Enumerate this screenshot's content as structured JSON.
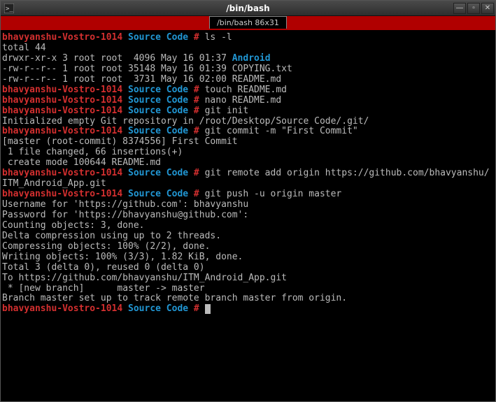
{
  "window": {
    "title": "/bin/bash"
  },
  "tab": {
    "label": "/bin/bash 86x31"
  },
  "prompt": {
    "host": "bhavyanshu-Vostro-1014",
    "cwd": "Source Code",
    "sep": " # "
  },
  "lines": [
    {
      "type": "prompt",
      "cmd": "ls -l"
    },
    {
      "type": "out",
      "text": "total 44"
    },
    {
      "type": "dir",
      "perm": "drwxr-xr-x 3 root root  4096 May 16 01:37 ",
      "name": "Android"
    },
    {
      "type": "out",
      "text": "-rw-r--r-- 1 root root 35148 May 16 01:39 COPYING.txt"
    },
    {
      "type": "out",
      "text": "-rw-r--r-- 1 root root  3731 May 16 02:00 README.md"
    },
    {
      "type": "prompt",
      "cmd": "touch README.md"
    },
    {
      "type": "prompt",
      "cmd": "nano README.md"
    },
    {
      "type": "prompt",
      "cmd": "git init"
    },
    {
      "type": "out",
      "text": "Initialized empty Git repository in /root/Desktop/Source Code/.git/"
    },
    {
      "type": "prompt",
      "cmd": "git commit -m \"First Commit\""
    },
    {
      "type": "out",
      "text": "[master (root-commit) 8374556] First Commit"
    },
    {
      "type": "out",
      "text": " 1 file changed, 66 insertions(+)"
    },
    {
      "type": "out",
      "text": " create mode 100644 README.md"
    },
    {
      "type": "prompt",
      "cmd": "git remote add origin https://github.com/bhavyanshu/ITM_Android_App.git"
    },
    {
      "type": "prompt",
      "cmd": "git push -u origin master"
    },
    {
      "type": "out",
      "text": "Username for 'https://github.com': bhavyanshu"
    },
    {
      "type": "out",
      "text": "Password for 'https://bhavyanshu@github.com':"
    },
    {
      "type": "out",
      "text": "Counting objects: 3, done."
    },
    {
      "type": "out",
      "text": "Delta compression using up to 2 threads."
    },
    {
      "type": "out",
      "text": "Compressing objects: 100% (2/2), done."
    },
    {
      "type": "out",
      "text": "Writing objects: 100% (3/3), 1.82 KiB, done."
    },
    {
      "type": "out",
      "text": "Total 3 (delta 0), reused 0 (delta 0)"
    },
    {
      "type": "out",
      "text": "To https://github.com/bhavyanshu/ITM_Android_App.git"
    },
    {
      "type": "out",
      "text": " * [new branch]      master -> master"
    },
    {
      "type": "out",
      "text": "Branch master set up to track remote branch master from origin."
    },
    {
      "type": "prompt",
      "cmd": "",
      "cursor": true
    }
  ]
}
